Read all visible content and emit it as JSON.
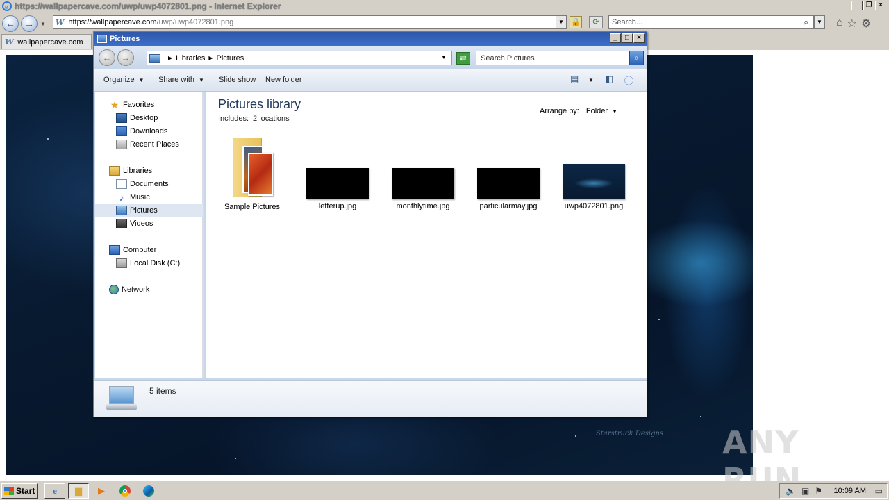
{
  "ie": {
    "title": "https://wallpapercave.com/uwp/uwp4072801.png - Internet Explorer",
    "address_host": "https://wallpapercave.com",
    "address_path": "/uwp/uwp4072801.png",
    "search_placeholder": "Search...",
    "tab_label": "wallpapercave.com",
    "wallpaper_signature": "Starstruck Designs"
  },
  "watermark": "ANY RUN",
  "explorer": {
    "title": "Pictures",
    "breadcrumb": [
      "Libraries",
      "Pictures"
    ],
    "search_placeholder": "Search Pictures",
    "commands": {
      "organize": "Organize",
      "share_with": "Share with",
      "slide_show": "Slide show",
      "new_folder": "New folder"
    },
    "nav": {
      "favorites": "Favorites",
      "desktop": "Desktop",
      "downloads": "Downloads",
      "recent_places": "Recent Places",
      "libraries": "Libraries",
      "documents": "Documents",
      "music": "Music",
      "pictures": "Pictures",
      "videos": "Videos",
      "computer": "Computer",
      "local_disk": "Local Disk (C:)",
      "network": "Network"
    },
    "library_title": "Pictures library",
    "includes_label": "Includes:",
    "includes_value": "2 locations",
    "arrange_label": "Arrange by:",
    "arrange_value": "Folder",
    "items": [
      {
        "name": "Sample Pictures",
        "type": "folder"
      },
      {
        "name": "letterup.jpg",
        "type": "black"
      },
      {
        "name": "monthlytime.jpg",
        "type": "black"
      },
      {
        "name": "particularmay.jpg",
        "type": "black"
      },
      {
        "name": "uwp4072801.png",
        "type": "wallpaper"
      }
    ],
    "status": "5 items"
  },
  "taskbar": {
    "start_label": "Start",
    "clock": "10:09 AM"
  }
}
